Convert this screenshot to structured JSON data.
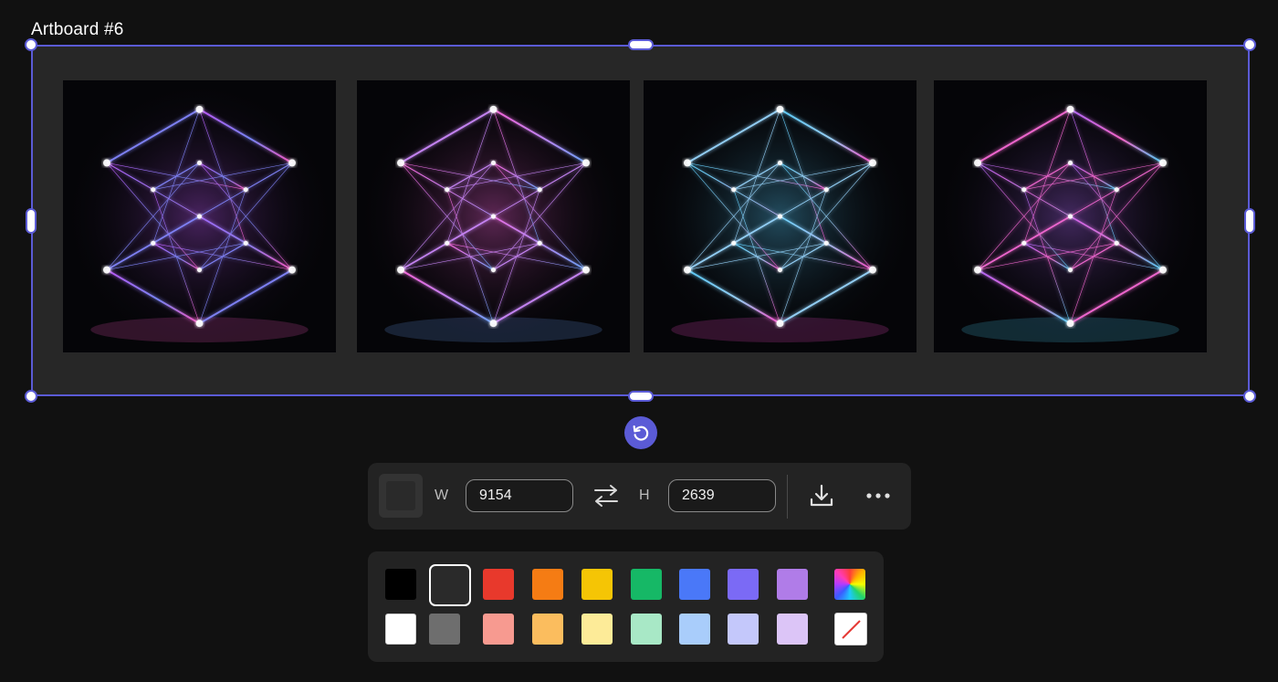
{
  "artboard": {
    "title": "Artboard #6",
    "images": [
      {
        "label": "neon-cube-image-1",
        "palette": [
          "#c45bff",
          "#ff58c8",
          "#7d8bff"
        ]
      },
      {
        "label": "neon-cube-image-2",
        "palette": [
          "#ff66e0",
          "#6ea7ff",
          "#c78cff"
        ]
      },
      {
        "label": "neon-cube-image-3",
        "palette": [
          "#5ad0ff",
          "#ff4fd0",
          "#9fd8ff"
        ]
      },
      {
        "label": "neon-cube-image-4",
        "palette": [
          "#b46bff",
          "#4fd6ff",
          "#ff6ad2"
        ]
      }
    ],
    "selection_color": "#5b5bd6"
  },
  "toolbar": {
    "width_label": "W",
    "width_value": "9154",
    "height_label": "H",
    "height_value": "2639",
    "icons": [
      "swap-icon",
      "download-icon",
      "more-icon"
    ],
    "fill_color": "#2a2a2a"
  },
  "palette": {
    "row1": [
      "#000000",
      "#2a2a2a",
      "#e8392c",
      "#f57c14",
      "#f5c505",
      "#16b866",
      "#4a78f8",
      "#7b6af5",
      "#b07ce8",
      "spectrum"
    ],
    "row2": [
      "#ffffff",
      "#6e6e6e",
      "#f79a90",
      "#fbbd5e",
      "#fdeb98",
      "#a8e8c6",
      "#a9cdfb",
      "#c4c8fb",
      "#dcc5f7",
      "none"
    ],
    "selected": "#2a2a2a"
  }
}
